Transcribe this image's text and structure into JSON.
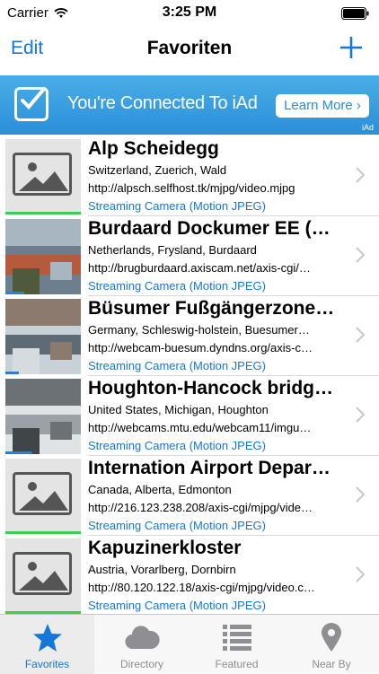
{
  "status": {
    "carrier": "Carrier",
    "time": "3:25 PM"
  },
  "nav": {
    "edit_label": "Edit",
    "title": "Favoriten"
  },
  "ad": {
    "text": "You're Connected To iAd",
    "button": "Learn More ›",
    "tag": "iAd"
  },
  "rows": [
    {
      "title": "Alp Scheidegg",
      "location": "Switzerland, Zuerich, Wald",
      "url": "http://alpsch.selfhost.tk/mjpg/video.mjpg",
      "type": "Streaming Camera (Motion JPEG)",
      "thumb": "placeholder",
      "progress": 1.0
    },
    {
      "title": "Burdaard Dockumer EE (…",
      "location": "Netherlands, Frysland, Burdaard",
      "url": "http://brugburdaard.axiscam.net/axis-cgi/…",
      "type": "Streaming Camera (Motion JPEG)",
      "thumb": "photo",
      "progress": 0.25
    },
    {
      "title": "Büsumer Fußgängerzone…",
      "location": "Germany, Schleswig-holstein, Buesumer…",
      "url": "http://webcam-buesum.dyndns.org/axis-c…",
      "type": "Streaming Camera (Motion JPEG)",
      "thumb": "photo",
      "progress": 0.18
    },
    {
      "title": "Houghton-Hancock bridg…",
      "location": "United States, Michigan, Houghton",
      "url": "http://webcams.mtu.edu/webcam11/imgu…",
      "type": "Streaming Camera (Motion JPEG)",
      "thumb": "photo",
      "progress": 0.35
    },
    {
      "title": "Internation Airport Depar…",
      "location": "Canada, Alberta, Edmonton",
      "url": "http://216.123.238.208/axis-cgi/mjpg/vide…",
      "type": "Streaming Camera (Motion JPEG)",
      "thumb": "placeholder",
      "progress": 1.0
    },
    {
      "title": "Kapuzinerkloster",
      "location": "Austria, Vorarlberg, Dornbirn",
      "url": "http://80.120.122.18/axis-cgi/mjpg/video.c…",
      "type": "Streaming Camera (Motion JPEG)",
      "thumb": "placeholder",
      "progress": 1.0
    }
  ],
  "tabs": [
    {
      "label": "Favorites",
      "icon": "star-icon",
      "active": true
    },
    {
      "label": "Directory",
      "icon": "cloud-icon",
      "active": false
    },
    {
      "label": "Featured",
      "icon": "list-icon",
      "active": false
    },
    {
      "label": "Near By",
      "icon": "location-pin-icon",
      "active": false
    }
  ],
  "colors": {
    "accent": "#1577d8",
    "ad_blue": "#2a8fd8",
    "progress_green": "#3ccf4e",
    "progress_blue": "#2b7fd6",
    "inactive_tab": "#8e8e93"
  }
}
